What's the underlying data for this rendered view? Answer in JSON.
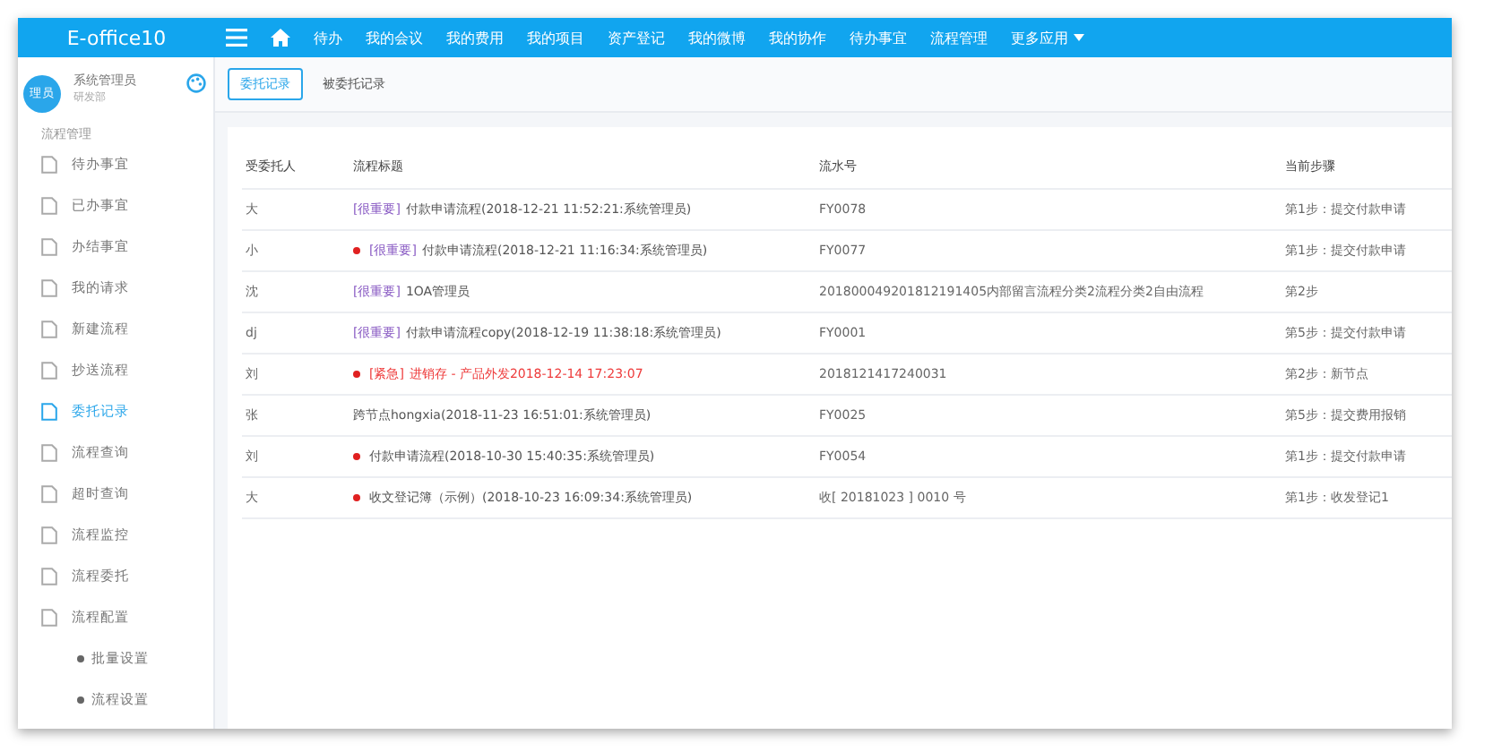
{
  "app": {
    "logo": "E-office10"
  },
  "nav": {
    "items": [
      "待办",
      "我的会议",
      "我的费用",
      "我的项目",
      "资产登记",
      "我的微博",
      "我的协作",
      "待办事宜",
      "流程管理"
    ],
    "more": "更多应用"
  },
  "user": {
    "avatar": "理员",
    "name": "系统管理员",
    "dept": "研发部"
  },
  "sidebar": {
    "section": "流程管理",
    "items": [
      {
        "label": "待办事宜",
        "selected": false
      },
      {
        "label": "已办事宜",
        "selected": false
      },
      {
        "label": "办结事宜",
        "selected": false
      },
      {
        "label": "我的请求",
        "selected": false
      },
      {
        "label": "新建流程",
        "selected": false
      },
      {
        "label": "抄送流程",
        "selected": false
      },
      {
        "label": "委托记录",
        "selected": true
      },
      {
        "label": "流程查询",
        "selected": false
      },
      {
        "label": "超时查询",
        "selected": false
      },
      {
        "label": "流程监控",
        "selected": false
      },
      {
        "label": "流程委托",
        "selected": false
      },
      {
        "label": "流程配置",
        "selected": false,
        "children": [
          {
            "label": "批量设置",
            "selected": false
          },
          {
            "label": "流程设置",
            "selected": false
          }
        ]
      }
    ]
  },
  "tabs": [
    {
      "label": "委托记录",
      "selected": true
    },
    {
      "label": "被委托记录",
      "selected": false
    }
  ],
  "table": {
    "columns": [
      "受委托人",
      "流程标题",
      "流水号",
      "当前步骤"
    ],
    "rows": [
      {
        "person": "大",
        "dot": false,
        "kind": "important",
        "tag": "[很重要]",
        "title": "付款申请流程(2018-12-21 11:52:21:系统管理员)",
        "serial": "FY0078",
        "step": "第1步：提交付款申请"
      },
      {
        "person": "小",
        "dot": true,
        "kind": "important",
        "tag": "[很重要]",
        "title": "付款申请流程(2018-12-21 11:16:34:系统管理员)",
        "serial": "FY0077",
        "step": "第1步：提交付款申请"
      },
      {
        "person": "沈",
        "dot": false,
        "kind": "important",
        "tag": "[很重要]",
        "title": "1OA管理员",
        "serial": "201800049201812191405内部留言流程分类2流程分类2自由流程",
        "step": "第2步"
      },
      {
        "person": "dj",
        "dot": false,
        "kind": "important",
        "tag": "[很重要]",
        "title": "付款申请流程copy(2018-12-19 11:38:18:系统管理员)",
        "serial": "FY0001",
        "step": "第5步：提交付款申请"
      },
      {
        "person": "刘",
        "dot": true,
        "kind": "urgent",
        "tag": "[紧急]",
        "title": "进销存 - 产品外发2018-12-14 17:23:07",
        "serial": "2018121417240031",
        "step": "第2步：新节点"
      },
      {
        "person": "张",
        "dot": false,
        "kind": "normal",
        "title": "跨节点hongxia(2018-11-23 16:51:01:系统管理员)",
        "serial": "FY0025",
        "step": "第5步：提交费用报销"
      },
      {
        "person": "刘",
        "dot": true,
        "kind": "normal",
        "title": "付款申请流程(2018-10-30 15:40:35:系统管理员)",
        "serial": "FY0054",
        "step": "第1步：提交付款申请"
      },
      {
        "person": "大",
        "dot": true,
        "kind": "normal",
        "title": "收文登记簿（示例）(2018-10-23 16:09:34:系统管理员)",
        "serial": "收[ 20181023 ] 0010 号",
        "step": "第1步：收发登记1"
      }
    ]
  }
}
